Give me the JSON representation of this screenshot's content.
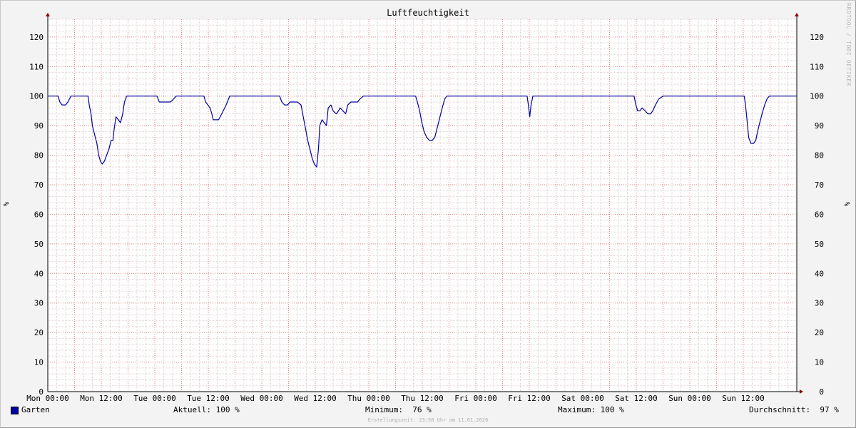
{
  "page": {
    "title": "Luftfeuchtigkeit",
    "watermark": "RRDTOOL / TOBI OETIKER",
    "footer": "Erstellungszeit: 23:58 Uhr am 11.01.2026"
  },
  "legend": {
    "series_name": "Garten",
    "aktuell": "Aktuell: 100 %",
    "minimum": "Minimum:  76 %",
    "maximum": "Maximum: 100 %",
    "durchschnitt": "Durchschnitt:  97 %"
  },
  "colors": {
    "series": "#0000a0",
    "minor_grid": "#e0d0d0",
    "major_grid": "#e08080",
    "axis": "#000000",
    "arrow": "#8b0000"
  },
  "chart_data": {
    "type": "line",
    "title": "Luftfeuchtigkeit",
    "ylabel": "%",
    "ylim": [
      0,
      126
    ],
    "xlim_hours": [
      0,
      168
    ],
    "yticks": [
      0,
      10,
      20,
      30,
      40,
      50,
      60,
      70,
      80,
      90,
      100,
      110,
      120
    ],
    "xticks": [
      {
        "hour": 0,
        "label": "Mon 00:00"
      },
      {
        "hour": 12,
        "label": "Mon 12:00"
      },
      {
        "hour": 24,
        "label": "Tue 00:00"
      },
      {
        "hour": 36,
        "label": "Tue 12:00"
      },
      {
        "hour": 48,
        "label": "Wed 00:00"
      },
      {
        "hour": 60,
        "label": "Wed 12:00"
      },
      {
        "hour": 72,
        "label": "Thu 00:00"
      },
      {
        "hour": 84,
        "label": "Thu 12:00"
      },
      {
        "hour": 96,
        "label": "Fri 00:00"
      },
      {
        "hour": 108,
        "label": "Fri 12:00"
      },
      {
        "hour": 120,
        "label": "Sat 00:00"
      },
      {
        "hour": 132,
        "label": "Sat 12:00"
      },
      {
        "hour": 144,
        "label": "Sun 00:00"
      },
      {
        "hour": 156,
        "label": "Sun 12:00"
      }
    ],
    "grid": true,
    "series": [
      {
        "name": "Garten",
        "points": [
          [
            0,
            100
          ],
          [
            2.3,
            100
          ],
          [
            2.7,
            98
          ],
          [
            3.2,
            97
          ],
          [
            4,
            97
          ],
          [
            4.5,
            98
          ],
          [
            5.2,
            100
          ],
          [
            9,
            100
          ],
          [
            9.3,
            97
          ],
          [
            9.7,
            94
          ],
          [
            10,
            90
          ],
          [
            10.5,
            87
          ],
          [
            11,
            84
          ],
          [
            11.4,
            80
          ],
          [
            11.8,
            78
          ],
          [
            12.2,
            77
          ],
          [
            12.7,
            78
          ],
          [
            13.2,
            80
          ],
          [
            13.7,
            82
          ],
          [
            14.2,
            85
          ],
          [
            14.6,
            85
          ],
          [
            14.9,
            89
          ],
          [
            15.3,
            93
          ],
          [
            15.8,
            92
          ],
          [
            16.3,
            91
          ],
          [
            16.8,
            94
          ],
          [
            17.2,
            98
          ],
          [
            17.7,
            100
          ],
          [
            24.5,
            100
          ],
          [
            25,
            98
          ],
          [
            27.5,
            98
          ],
          [
            28.2,
            99
          ],
          [
            28.8,
            100
          ],
          [
            35,
            100
          ],
          [
            35.4,
            98
          ],
          [
            35.9,
            97
          ],
          [
            36.4,
            96
          ],
          [
            36.8,
            94
          ],
          [
            37.1,
            92
          ],
          [
            37.6,
            92
          ],
          [
            38.3,
            92
          ],
          [
            39,
            94
          ],
          [
            40,
            97
          ],
          [
            40.8,
            100
          ],
          [
            52,
            100
          ],
          [
            52.5,
            98
          ],
          [
            53.1,
            97
          ],
          [
            53.8,
            97
          ],
          [
            54.3,
            98
          ],
          [
            56,
            98
          ],
          [
            56.8,
            97
          ],
          [
            57.3,
            93
          ],
          [
            57.8,
            89
          ],
          [
            58.3,
            85
          ],
          [
            58.8,
            82
          ],
          [
            59.3,
            79
          ],
          [
            59.8,
            77
          ],
          [
            60.3,
            76
          ],
          [
            60.7,
            82
          ],
          [
            61,
            90
          ],
          [
            61.5,
            92
          ],
          [
            62,
            91
          ],
          [
            62.5,
            90
          ],
          [
            62.9,
            96
          ],
          [
            63.5,
            97
          ],
          [
            64,
            95
          ],
          [
            64.7,
            94
          ],
          [
            65.2,
            95
          ],
          [
            65.6,
            96
          ],
          [
            66.2,
            95
          ],
          [
            66.8,
            94
          ],
          [
            67.3,
            97
          ],
          [
            68,
            98
          ],
          [
            69.5,
            98
          ],
          [
            70,
            99
          ],
          [
            70.8,
            100
          ],
          [
            82.5,
            100
          ],
          [
            82.9,
            98
          ],
          [
            83.4,
            95
          ],
          [
            83.9,
            91
          ],
          [
            84.4,
            88
          ],
          [
            85,
            86
          ],
          [
            85.6,
            85
          ],
          [
            86.2,
            85
          ],
          [
            86.8,
            86
          ],
          [
            87.3,
            89
          ],
          [
            87.8,
            92
          ],
          [
            88.3,
            95
          ],
          [
            89,
            99
          ],
          [
            89.5,
            100
          ],
          [
            107.5,
            100
          ],
          [
            107.8,
            97
          ],
          [
            108.1,
            93
          ],
          [
            108.4,
            97
          ],
          [
            108.8,
            100
          ],
          [
            131.5,
            100
          ],
          [
            131.9,
            97
          ],
          [
            132.3,
            95
          ],
          [
            132.8,
            95
          ],
          [
            133.3,
            96
          ],
          [
            134,
            95
          ],
          [
            134.6,
            94
          ],
          [
            135.2,
            94
          ],
          [
            135.7,
            95
          ],
          [
            136.3,
            97
          ],
          [
            137,
            99
          ],
          [
            138,
            100
          ],
          [
            156.2,
            100
          ],
          [
            156.5,
            97
          ],
          [
            156.9,
            91
          ],
          [
            157.2,
            86
          ],
          [
            157.7,
            84
          ],
          [
            158.3,
            84
          ],
          [
            158.8,
            85
          ],
          [
            159.2,
            88
          ],
          [
            159.7,
            91
          ],
          [
            160.2,
            94
          ],
          [
            160.8,
            97
          ],
          [
            161.3,
            99
          ],
          [
            161.8,
            100
          ],
          [
            168,
            100
          ]
        ]
      }
    ]
  }
}
